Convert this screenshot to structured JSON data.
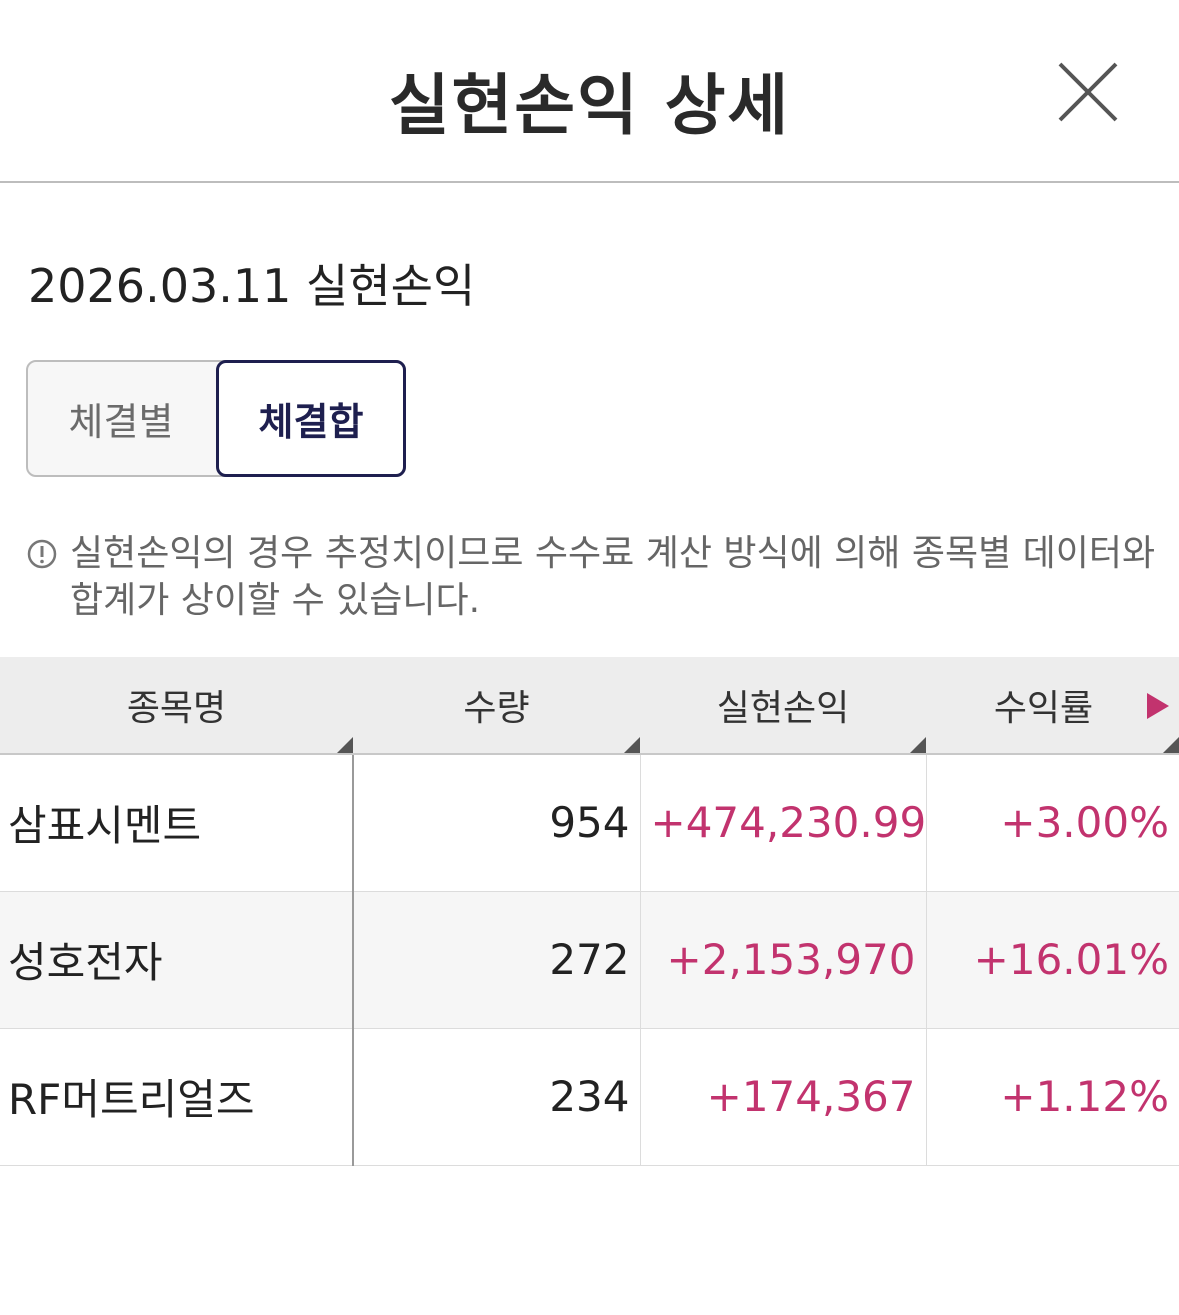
{
  "header": {
    "title": "실현손익 상세",
    "close_icon": "close-icon"
  },
  "summary": {
    "date_title": "2026.03.11 실현손익"
  },
  "segment": {
    "left_label": "체결별",
    "right_label": "체결합",
    "selected": "체결합"
  },
  "notice": {
    "icon": "info-icon",
    "text": "실현손익의 경우 추정치이므로 수수료 계산 방식에 의해 종목별 데이터와 합계가 상이할 수 있습니다."
  },
  "table": {
    "headers": [
      "종목명",
      "수량",
      "실현손익",
      "수익률"
    ],
    "rows": [
      {
        "name": "삼표시멘트",
        "qty": "954",
        "pnl": "+474,230.99",
        "rate": "+3.00%"
      },
      {
        "name": "성호전자",
        "qty": "272",
        "pnl": "+2,153,970",
        "rate": "+16.01%"
      },
      {
        "name": "RF머트리얼즈",
        "qty": "234",
        "pnl": "+174,367",
        "rate": "+1.12%"
      }
    ]
  },
  "colors": {
    "accent_navy": "#1e1f4f",
    "profit_pink": "#c2336e",
    "scroll_arrow": "#c2336e"
  }
}
